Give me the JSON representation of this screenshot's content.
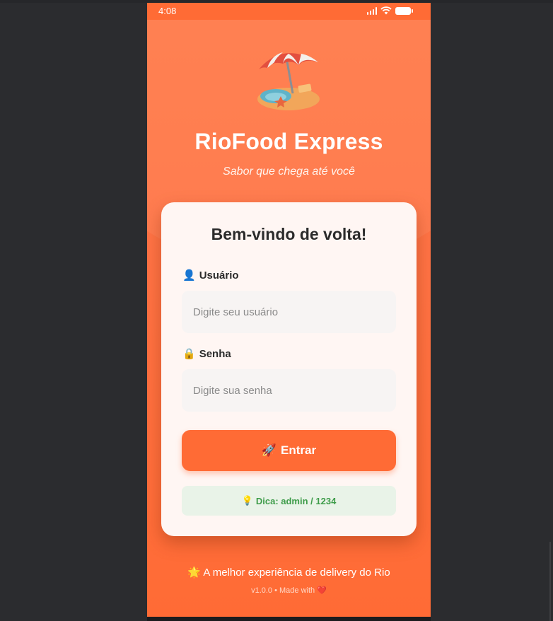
{
  "status_bar": {
    "time": "4:08"
  },
  "app": {
    "logo_icon": "beach-umbrella-icon",
    "title": "RioFood Express",
    "subtitle": "Sabor que chega até você"
  },
  "login": {
    "heading": "Bem-vindo de volta!",
    "username": {
      "icon": "👤",
      "label": "Usuário",
      "placeholder": "Digite seu usuário",
      "value": ""
    },
    "password": {
      "icon": "🔒",
      "label": "Senha",
      "placeholder": "Digite sua senha",
      "value": ""
    },
    "submit": {
      "icon": "🚀",
      "label": "Entrar"
    },
    "hint": {
      "icon": "💡",
      "text": "Dica: admin / 1234"
    }
  },
  "footer": {
    "icon": "🌟",
    "tagline": "A melhor experiência de delivery do Rio",
    "version": "v1.0.0 • Made with",
    "heart": "❤️"
  },
  "colors": {
    "primary": "#ff6b35",
    "card": "#fff6f3",
    "hint_bg": "#e9f3e8",
    "hint_text": "#3e9c4a"
  }
}
